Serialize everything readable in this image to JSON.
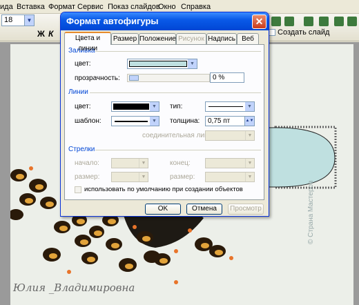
{
  "menubar": {
    "items": [
      "ида",
      "Вставка",
      "Формат",
      "Сервис",
      "Показ слайдов",
      "Окно",
      "Справка"
    ]
  },
  "toolbar": {
    "font_size": "18",
    "bold_label": "Ж",
    "italic_label": "К",
    "create_slide_label": "Создать слайд"
  },
  "dialog": {
    "title": "Формат автофигуры",
    "close_glyph": "✕",
    "tabs": [
      "Цвета и линии",
      "Размер",
      "Положение",
      "Рисунок",
      "Надпись",
      "Веб"
    ],
    "active_tab": "Цвета и линии",
    "fill": {
      "group_label": "Заливка",
      "color_label": "цвет:",
      "color_value": "#bfe0e0",
      "transparency_label": "прозрачность:",
      "transparency_value": "0 %"
    },
    "lines": {
      "group_label": "Линии",
      "color_label": "цвет:",
      "color_value": "#000000",
      "type_label": "тип:",
      "pattern_label": "шаблон:",
      "weight_label": "толщина:",
      "weight_value": "0,75 пт",
      "connector_label": "соединительная линия:"
    },
    "arrows": {
      "group_label": "Стрелки",
      "begin_label": "начало:",
      "end_label": "конец:",
      "begin_size_label": "размер:",
      "end_size_label": "размер:"
    },
    "default_checkbox_label": "использовать по умолчанию при создании объектов",
    "ok_label": "OK",
    "cancel_label": "Отмена",
    "preview_label": "Просмотр"
  },
  "slide": {
    "caption": "Юлия _Владимировна",
    "watermark": "© Страна Мастеров"
  },
  "colors": {
    "title_blue": "#0a5ae8",
    "ellipse_fill": "#bfe0e0",
    "group_label": "#0046d5"
  }
}
